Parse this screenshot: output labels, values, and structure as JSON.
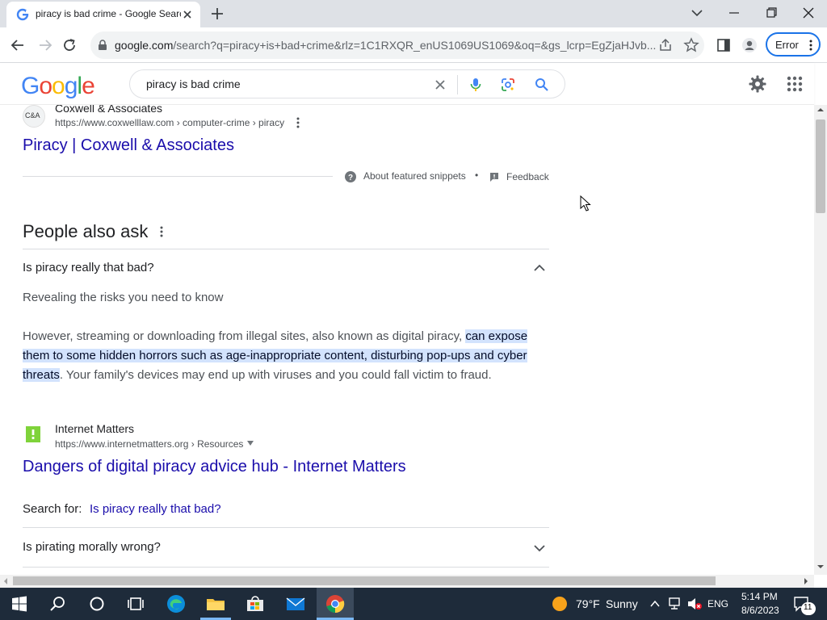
{
  "browser": {
    "tab_title": "piracy is bad crime - Google Search",
    "url_prefix": "google.com",
    "url_rest": "/search?q=piracy+is+bad+crime&rlz=1C1RXQR_enUS1069US1069&oq=&gs_lcrp=EgZjaHJvb...",
    "error_label": "Error"
  },
  "google": {
    "logo": "Google",
    "logo_colors": [
      "#4285f4",
      "#ea4335",
      "#fbbc05",
      "#4285f4",
      "#34a853",
      "#ea4335"
    ],
    "query": "piracy is bad crime"
  },
  "result1": {
    "site_icon_text": "C&A",
    "site_name": "Coxwell & Associates",
    "breadcrumb": "https://www.coxwelllaw.com › computer-crime › piracy",
    "title": "Piracy | Coxwell & Associates"
  },
  "snippet_footer": {
    "about": "About featured snippets",
    "dot": "•",
    "feedback": "Feedback"
  },
  "paa": {
    "heading": "People also ask",
    "q1": {
      "question": "Is piracy really that bad?",
      "subhead": "Revealing the risks you need to know",
      "body_before": "However, streaming or downloading from illegal sites, also known as digital piracy, ",
      "body_highlight": "can expose them to some hidden horrors such as age-inappropriate content, disturbing pop-ups and cyber threats",
      "body_after": ". Your family's devices may end up with viruses and you could fall victim to fraud.",
      "source_name": "Internet Matters",
      "source_breadcrumb": "https://www.internetmatters.org › Resources",
      "source_title": "Dangers of digital piracy advice hub - Internet Matters",
      "search_for_label": "Search for:",
      "search_for_link": "Is piracy really that bad?"
    },
    "q2": {
      "question": "Is pirating morally wrong?"
    }
  },
  "taskbar": {
    "weather_temp": "79°F",
    "weather_desc": "Sunny",
    "lang": "ENG",
    "time": "5:14 PM",
    "date": "8/6/2023",
    "notif_count": "11"
  },
  "colors": {
    "link": "#1a0dab",
    "highlight": "#d3e3fd",
    "accent": "#1a73e8"
  }
}
